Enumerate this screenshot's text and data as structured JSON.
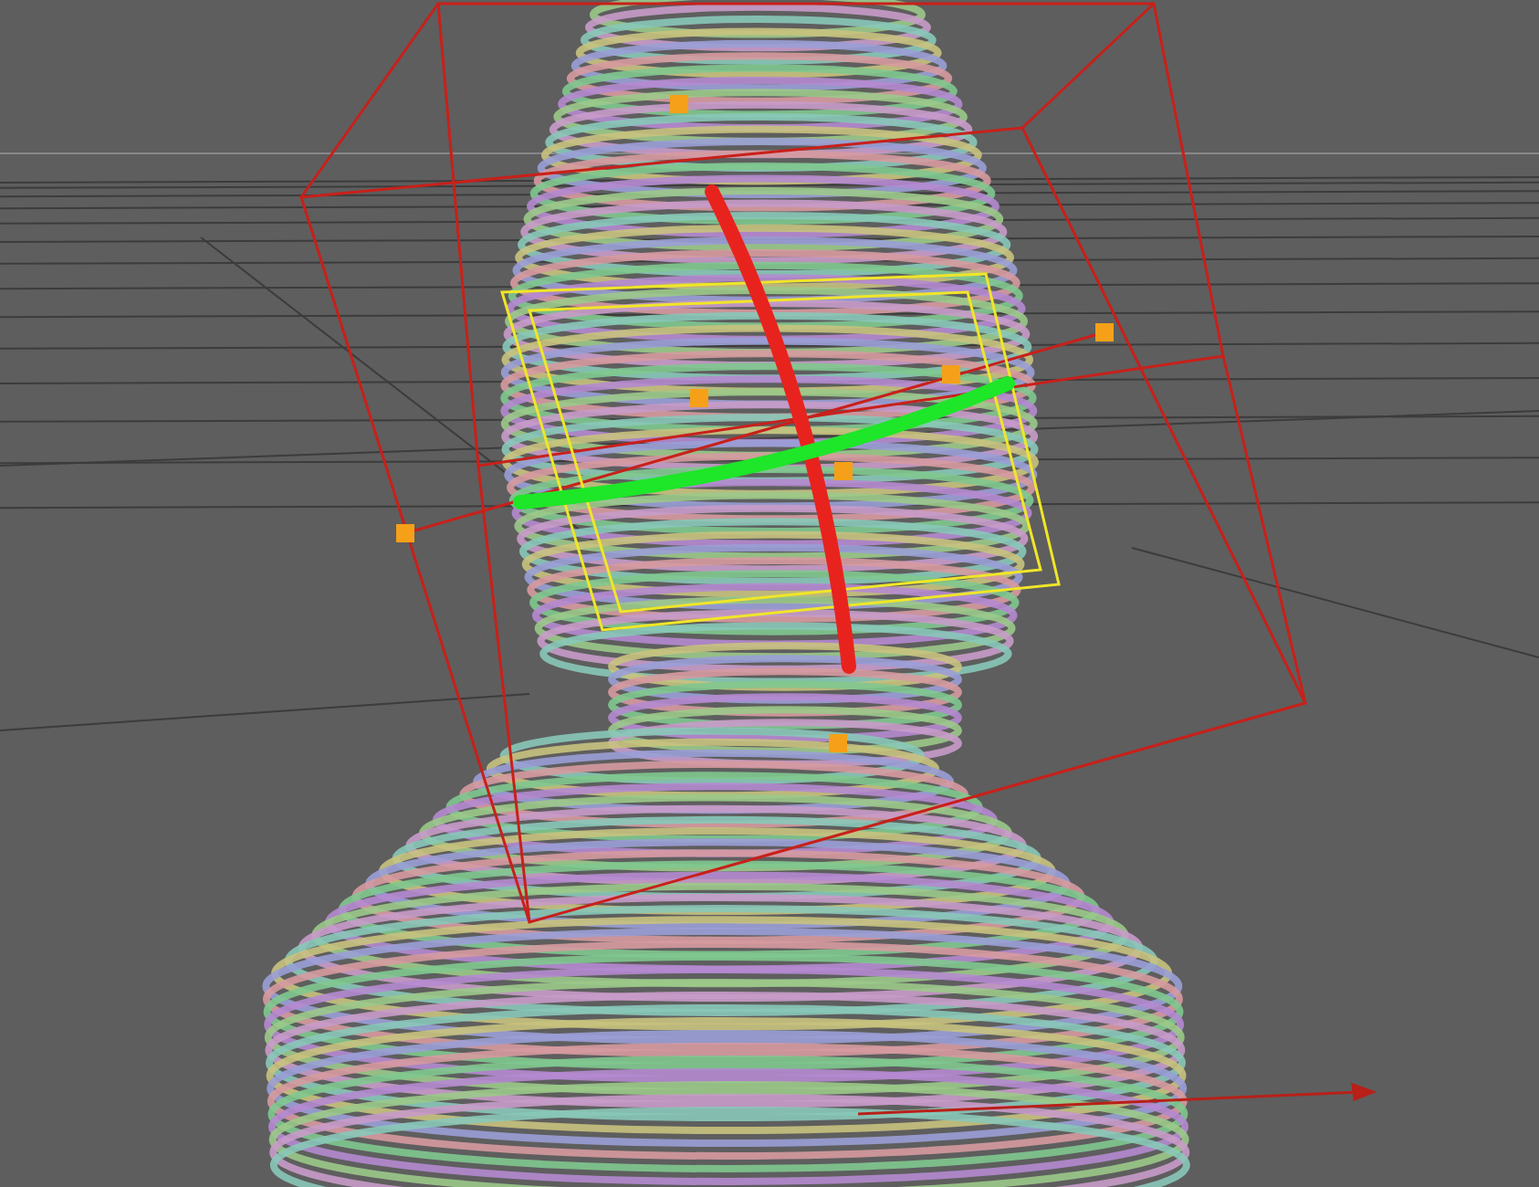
{
  "viewport": {
    "grid": true,
    "selection_box": true,
    "handles": true,
    "rotation_arcs": [
      {
        "color": "#e8231e"
      },
      {
        "color": "#1ee628"
      }
    ]
  }
}
